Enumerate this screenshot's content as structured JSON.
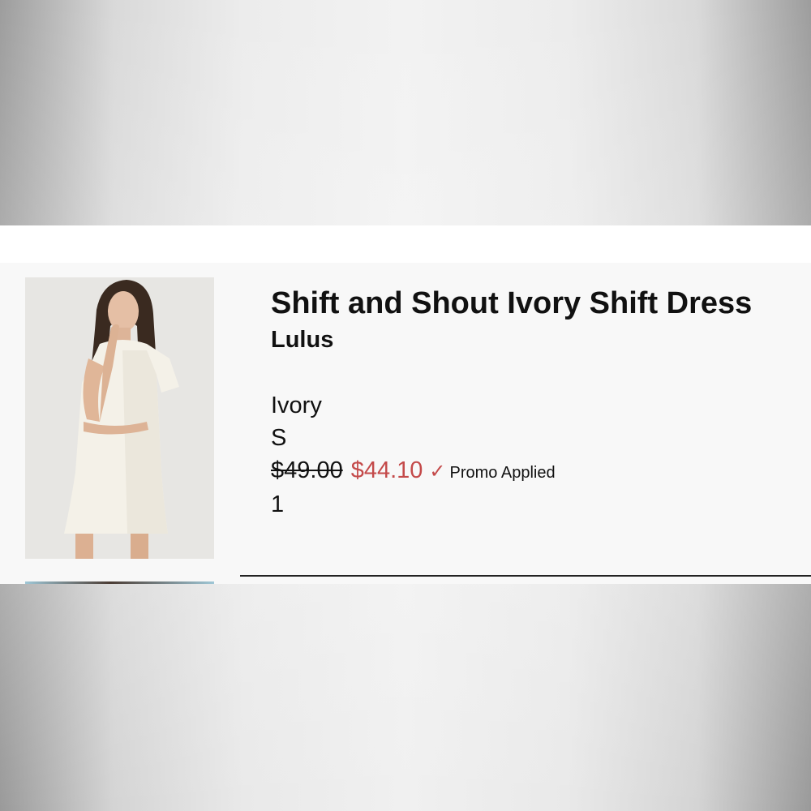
{
  "product": {
    "title": "Shift and Shout Ivory Shift Dress",
    "brand": "Lulus",
    "color": "Ivory",
    "size": "S",
    "original_price": "$49.00",
    "sale_price": "$44.10",
    "promo_check": "✓",
    "promo_label": "Promo Applied",
    "quantity": "1",
    "image_icon": "dress-photo"
  },
  "colors": {
    "sale": "#c44a4a",
    "text": "#111111",
    "card": "#f8f8f8"
  }
}
